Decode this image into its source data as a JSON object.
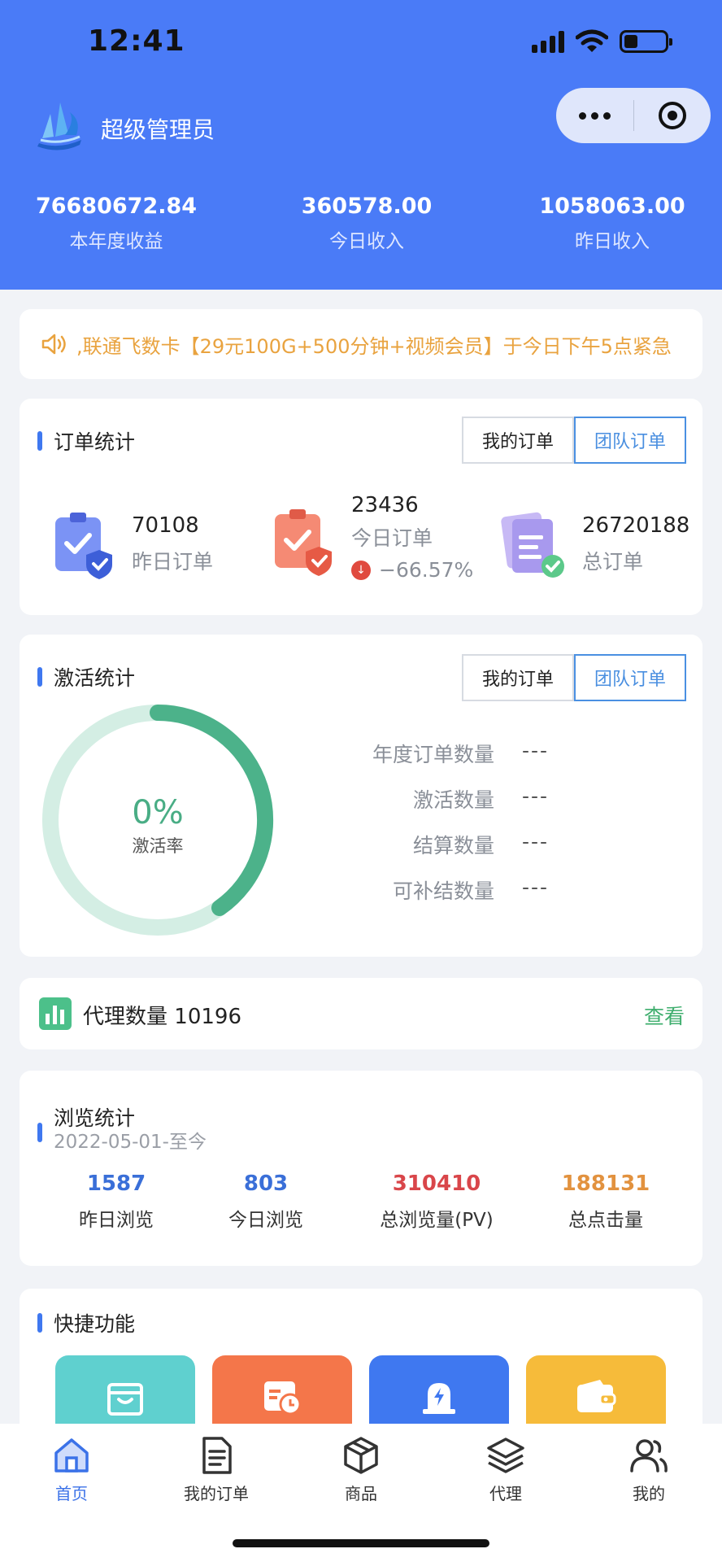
{
  "status_bar": {
    "time": "12:41"
  },
  "header": {
    "admin_name": "超级管理员",
    "stats": [
      {
        "value": "76680672.84",
        "label": "本年度收益"
      },
      {
        "value": "360578.00",
        "label": "今日收入"
      },
      {
        "value": "1058063.00",
        "label": "昨日收入"
      }
    ]
  },
  "notice": {
    "text": ",联通飞数卡【29元100G+500分钟+视频会员】于今日下午5点紧急"
  },
  "order_stats": {
    "title": "订单统计",
    "tabs": [
      "我的订单",
      "团队订单"
    ],
    "items": [
      {
        "value": "70108",
        "label": "昨日订单"
      },
      {
        "value": "23436",
        "label": "今日订单",
        "delta": "−66.57%"
      },
      {
        "value": "26720188",
        "label": "总订单"
      }
    ]
  },
  "activation_stats": {
    "title": "激活统计",
    "tabs": [
      "我的订单",
      "团队订单"
    ],
    "rate_value": "0%",
    "rate_label": "激活率",
    "rows": [
      {
        "label": "年度订单数量",
        "value": "---"
      },
      {
        "label": "激活数量",
        "value": "---"
      },
      {
        "label": "结算数量",
        "value": "---"
      },
      {
        "label": "可补结数量",
        "value": "---"
      }
    ]
  },
  "agent": {
    "label": "代理数量",
    "count": "10196",
    "view": "查看"
  },
  "browse_stats": {
    "title": "浏览统计",
    "date_range": "2022-05-01-至今",
    "items": [
      {
        "value": "1587",
        "label": "昨日浏览",
        "color": "#3a6fd8"
      },
      {
        "value": "803",
        "label": "今日浏览",
        "color": "#3a6fd8"
      },
      {
        "value": "310410",
        "label": "总浏览量(PV)",
        "color": "#d9464a"
      },
      {
        "value": "188131",
        "label": "总点击量",
        "color": "#e2923f"
      }
    ]
  },
  "quick": {
    "title": "快捷功能",
    "tile_colors": [
      "#5fd0cf",
      "#f4764a",
      "#3f78f0",
      "#f6bb3a"
    ]
  },
  "tabbar": {
    "items": [
      {
        "label": "首页",
        "icon": "home-icon"
      },
      {
        "label": "我的订单",
        "icon": "document-icon"
      },
      {
        "label": "商品",
        "icon": "box-icon"
      },
      {
        "label": "代理",
        "icon": "layers-icon"
      },
      {
        "label": "我的",
        "icon": "users-icon"
      }
    ]
  },
  "colors": {
    "brand": "#4a7bf7",
    "accent_green": "#49ad85",
    "notice": "#e9a33f"
  }
}
